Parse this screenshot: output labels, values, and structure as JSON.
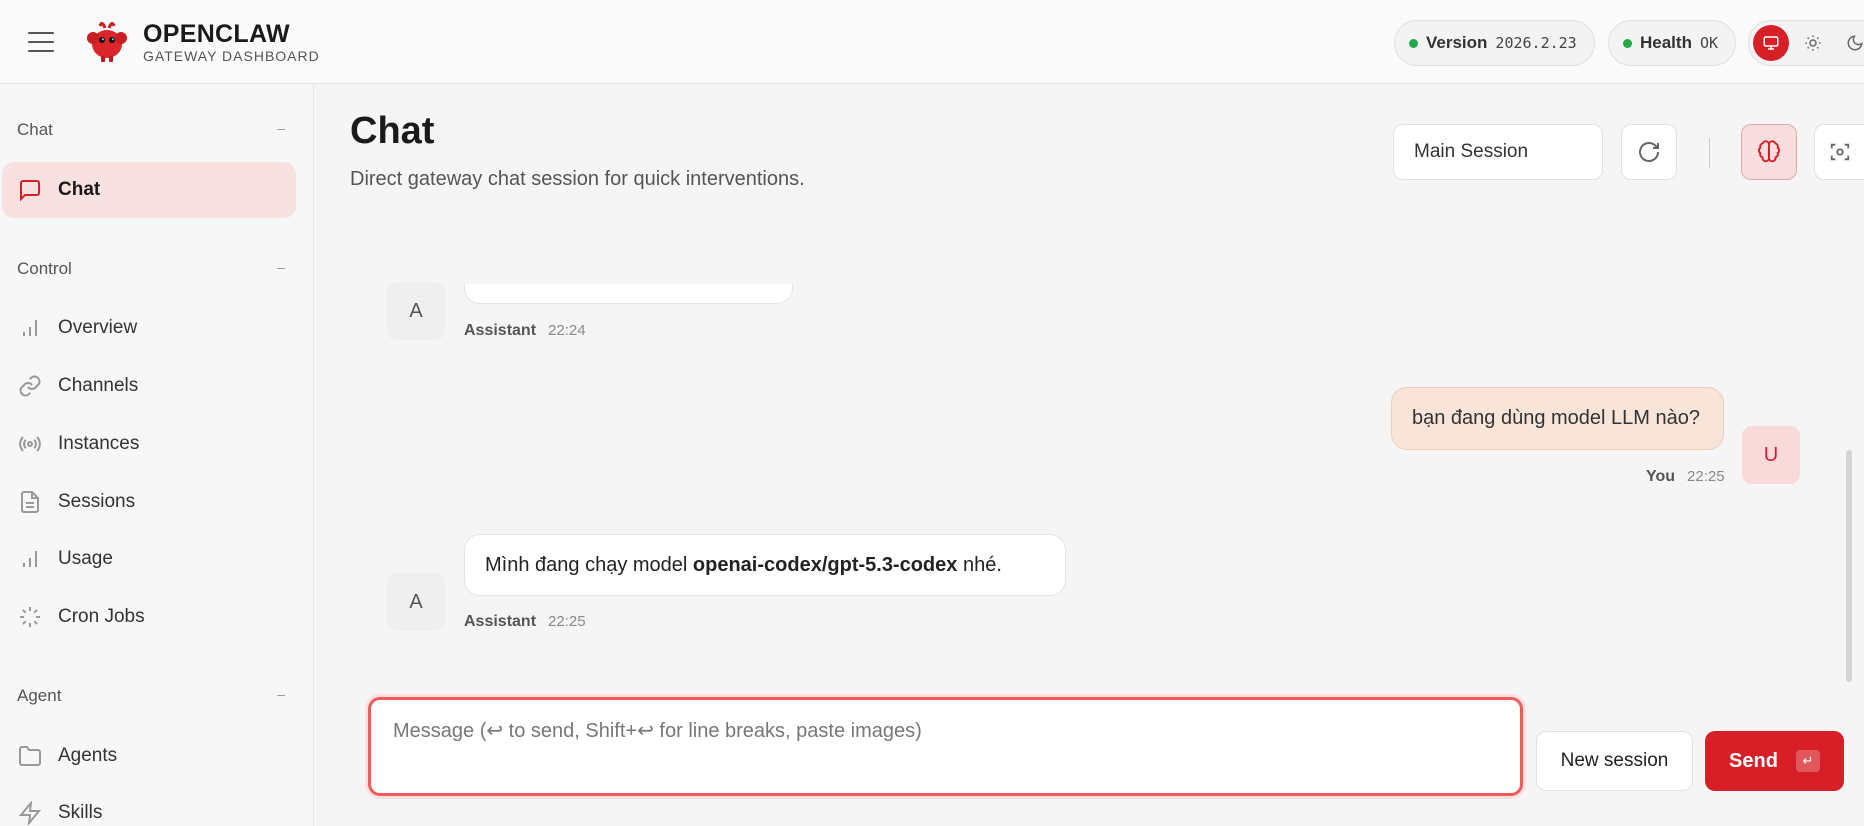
{
  "brand": {
    "title": "OPENCLAW",
    "subtitle": "GATEWAY DASHBOARD"
  },
  "status": {
    "version_label": "Version",
    "version_value": "2026.2.23",
    "health_label": "Health",
    "health_value": "OK",
    "ok_color": "#22a94a"
  },
  "theme": {
    "options": [
      "monitor-icon",
      "sun-icon",
      "moon-icon"
    ],
    "active": "monitor-icon",
    "accent": "#d61f26"
  },
  "sidebar": {
    "sections": [
      {
        "title": "Chat",
        "collapse": "–",
        "items": [
          {
            "label": "Chat",
            "icon": "message-icon",
            "active": true
          }
        ]
      },
      {
        "title": "Control",
        "collapse": "–",
        "items": [
          {
            "label": "Overview",
            "icon": "bar-chart-icon"
          },
          {
            "label": "Channels",
            "icon": "link-icon"
          },
          {
            "label": "Instances",
            "icon": "radio-icon"
          },
          {
            "label": "Sessions",
            "icon": "file-icon"
          },
          {
            "label": "Usage",
            "icon": "bar-chart-icon"
          },
          {
            "label": "Cron Jobs",
            "icon": "loader-icon"
          }
        ]
      },
      {
        "title": "Agent",
        "collapse": "–",
        "items": [
          {
            "label": "Agents",
            "icon": "folder-icon"
          },
          {
            "label": "Skills",
            "icon": "zap-icon"
          }
        ]
      }
    ]
  },
  "main": {
    "title": "Chat",
    "subtitle": "Direct gateway chat session for quick interventions.",
    "session_select": "Main Session"
  },
  "messages": [
    {
      "role": "assistant",
      "avatar": "A",
      "author": "Assistant",
      "time": "22:24",
      "text": ""
    },
    {
      "role": "user",
      "avatar": "U",
      "author": "You",
      "time": "22:25",
      "text": "bạn đang dùng model LLM nào?"
    },
    {
      "role": "assistant",
      "avatar": "A",
      "author": "Assistant",
      "time": "22:25",
      "text_before": "Mình đang chạy model ",
      "text_bold": "openai-codex/gpt-5.3-codex",
      "text_after": " nhé."
    }
  ],
  "composer": {
    "placeholder": "Message (↩ to send, Shift+↩ for line breaks, paste images)",
    "new_session_label": "New session",
    "send_label": "Send",
    "send_key": "↵"
  }
}
